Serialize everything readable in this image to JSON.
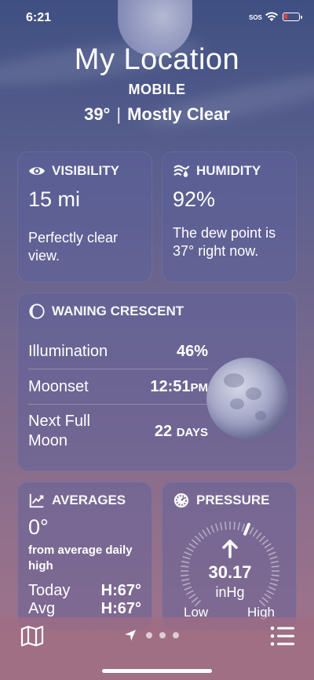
{
  "status_bar": {
    "time": "6:21",
    "sos": "SOS"
  },
  "header": {
    "location": "My Location",
    "sublocation": "MOBILE",
    "temperature": "39°",
    "separator": "|",
    "condition": "Mostly Clear"
  },
  "visibility": {
    "title": "VISIBILITY",
    "value": "15 mi",
    "description": "Perfectly clear view.",
    "icon": "eye-icon"
  },
  "humidity": {
    "title": "HUMIDITY",
    "value": "92%",
    "description": "The dew point is 37° right now.",
    "icon": "humidity-icon"
  },
  "moon": {
    "title": "WANING CRESCENT",
    "icon": "moon-phase-icon",
    "rows": [
      {
        "label": "Illumination",
        "value": "46%",
        "unit": ""
      },
      {
        "label": "Moonset",
        "value": "12:51",
        "unit": "PM"
      },
      {
        "label": "Next Full Moon",
        "value": "22",
        "unit": "DAYS"
      }
    ]
  },
  "averages": {
    "title": "AVERAGES",
    "value": "0°",
    "note": "from average daily high",
    "rows": [
      {
        "label": "Today",
        "value": "H:67°"
      },
      {
        "label": "Avg",
        "value": "H:67°"
      }
    ]
  },
  "pressure": {
    "title": "PRESSURE",
    "value": "30.17",
    "unit": "inHg",
    "low_label": "Low",
    "high_label": "High",
    "trend": "rising"
  },
  "tab_bar": {
    "map_icon": "map-icon",
    "location_icon": "location-arrow-icon",
    "page_dots": 3,
    "list_icon": "list-icon"
  }
}
